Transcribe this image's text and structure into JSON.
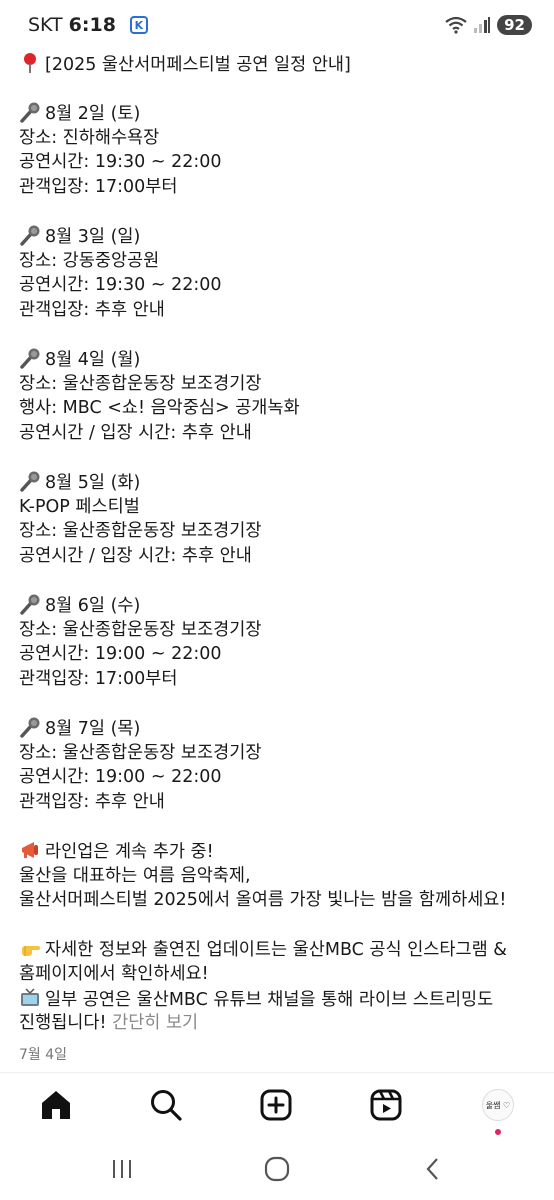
{
  "status_bar": {
    "carrier": "SKT",
    "time": "6:18",
    "app_badge": "K",
    "battery": "92"
  },
  "post": {
    "lines": [
      {
        "emoji": "pin-emoji",
        "text": "[2025 울산서머페스티벌 공연 일정 안내]"
      },
      {
        "gap": true
      },
      {
        "emoji": "microphone-emoji",
        "text": "8월 2일 (토)"
      },
      {
        "text": "장소: 진하해수욕장"
      },
      {
        "text": "공연시간: 19:30 ~ 22:00"
      },
      {
        "text": "관객입장: 17:00부터"
      },
      {
        "gap": true
      },
      {
        "emoji": "microphone-emoji",
        "text": "8월 3일 (일)"
      },
      {
        "text": "장소: 강동중앙공원"
      },
      {
        "text": "공연시간: 19:30 ~ 22:00"
      },
      {
        "text": "관객입장: 추후 안내"
      },
      {
        "gap": true
      },
      {
        "emoji": "microphone-emoji",
        "text": "8월 4일 (월)"
      },
      {
        "text": "장소: 울산종합운동장 보조경기장"
      },
      {
        "text": "행사: MBC <쇼! 음악중심> 공개녹화"
      },
      {
        "text": "공연시간 / 입장 시간: 추후 안내"
      },
      {
        "gap": true
      },
      {
        "emoji": "microphone-emoji",
        "text": "8월 5일 (화)"
      },
      {
        "text": "K-POP 페스티벌"
      },
      {
        "text": "장소: 울산종합운동장 보조경기장"
      },
      {
        "text": "공연시간 / 입장 시간: 추후 안내"
      },
      {
        "gap": true
      },
      {
        "emoji": "microphone-emoji",
        "text": "8월 6일 (수)"
      },
      {
        "text": "장소: 울산종합운동장 보조경기장"
      },
      {
        "text": "공연시간: 19:00 ~ 22:00"
      },
      {
        "text": "관객입장: 17:00부터"
      },
      {
        "gap": true
      },
      {
        "emoji": "microphone-emoji",
        "text": "8월 7일 (목)"
      },
      {
        "text": "장소: 울산종합운동장 보조경기장"
      },
      {
        "text": "공연시간: 19:00 ~ 22:00"
      },
      {
        "text": "관객입장: 추후 안내"
      },
      {
        "gap": true
      },
      {
        "emoji": "megaphone-emoji",
        "text": "라인업은 계속 추가 중!"
      },
      {
        "text": "울산을 대표하는 여름 음악축제,"
      },
      {
        "text": "울산서머페스티벌 2025에서 올여름 가장 빛나는 밤을 함께하세요!"
      },
      {
        "gap": true
      },
      {
        "emoji": "pointing-hand-emoji",
        "text": "자세한 정보와 출연진 업데이트는 울산MBC 공식 인스타그램 &"
      },
      {
        "text": "홈페이지에서 확인하세요!"
      },
      {
        "emoji": "television-emoji",
        "text": "일부 공연은 울산MBC 유튜브 채널을 통해 라이브 스트리밍도"
      },
      {
        "text": "진행됩니다!",
        "more": "간단히 보기"
      }
    ],
    "date": "7월 4일"
  },
  "bottom_nav": {
    "items": [
      "home-icon",
      "search-icon",
      "create-icon",
      "reels-icon",
      "profile-avatar"
    ],
    "avatar_text": "울쌤 ♡",
    "notification_color": "#e0245e"
  },
  "system_nav": {
    "items": [
      "recent-apps-icon",
      "home-button-icon",
      "back-icon"
    ]
  }
}
